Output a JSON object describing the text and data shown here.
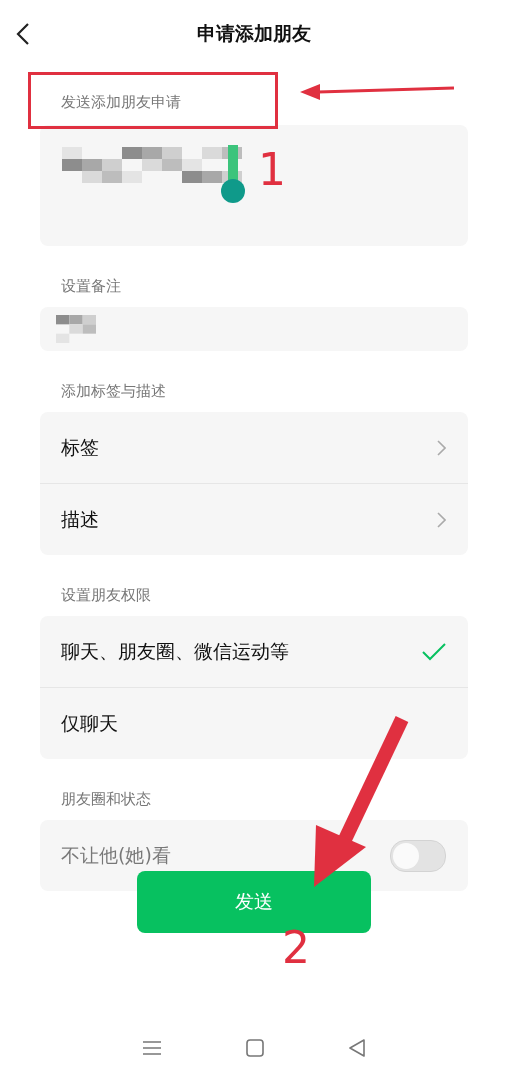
{
  "header": {
    "title": "申请添加朋友"
  },
  "sections": [
    {
      "kind": "textarea",
      "label": "发送添加朋友申请"
    },
    {
      "kind": "input",
      "label": "设置备注"
    },
    {
      "kind": "links",
      "label": "添加标签与描述",
      "items": [
        {
          "label": "标签"
        },
        {
          "label": "描述"
        }
      ]
    },
    {
      "kind": "options",
      "label": "设置朋友权限",
      "items": [
        {
          "label": "聊天、朋友圈、微信运动等",
          "selected": true
        },
        {
          "label": "仅聊天",
          "selected": false
        }
      ]
    },
    {
      "kind": "toggles",
      "label": "朋友圈和状态",
      "items": [
        {
          "label": "不让他(她)看",
          "on": false
        }
      ]
    }
  ],
  "send_button": "发送",
  "annotations": {
    "markers": [
      "1",
      "2"
    ]
  }
}
